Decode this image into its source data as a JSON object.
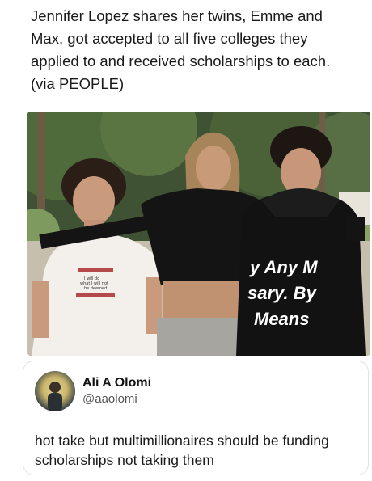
{
  "post": {
    "text": "Jennifer Lopez shares her twins, Emme and\nMax, got accepted to all five colleges they\napplied to and received scholarships to each.\n(via PEOPLE)"
  },
  "photo": {
    "shirt_text": "I will do\nwhat I will not\nbe deemed",
    "sweatshirt_text": [
      "y Any M",
      "sary. By",
      "Means"
    ]
  },
  "quoted_post": {
    "name": "Ali A Olomi",
    "handle": "@aaolomi",
    "text": "hot take but multimillionaires should be funding scholarships not taking them"
  }
}
